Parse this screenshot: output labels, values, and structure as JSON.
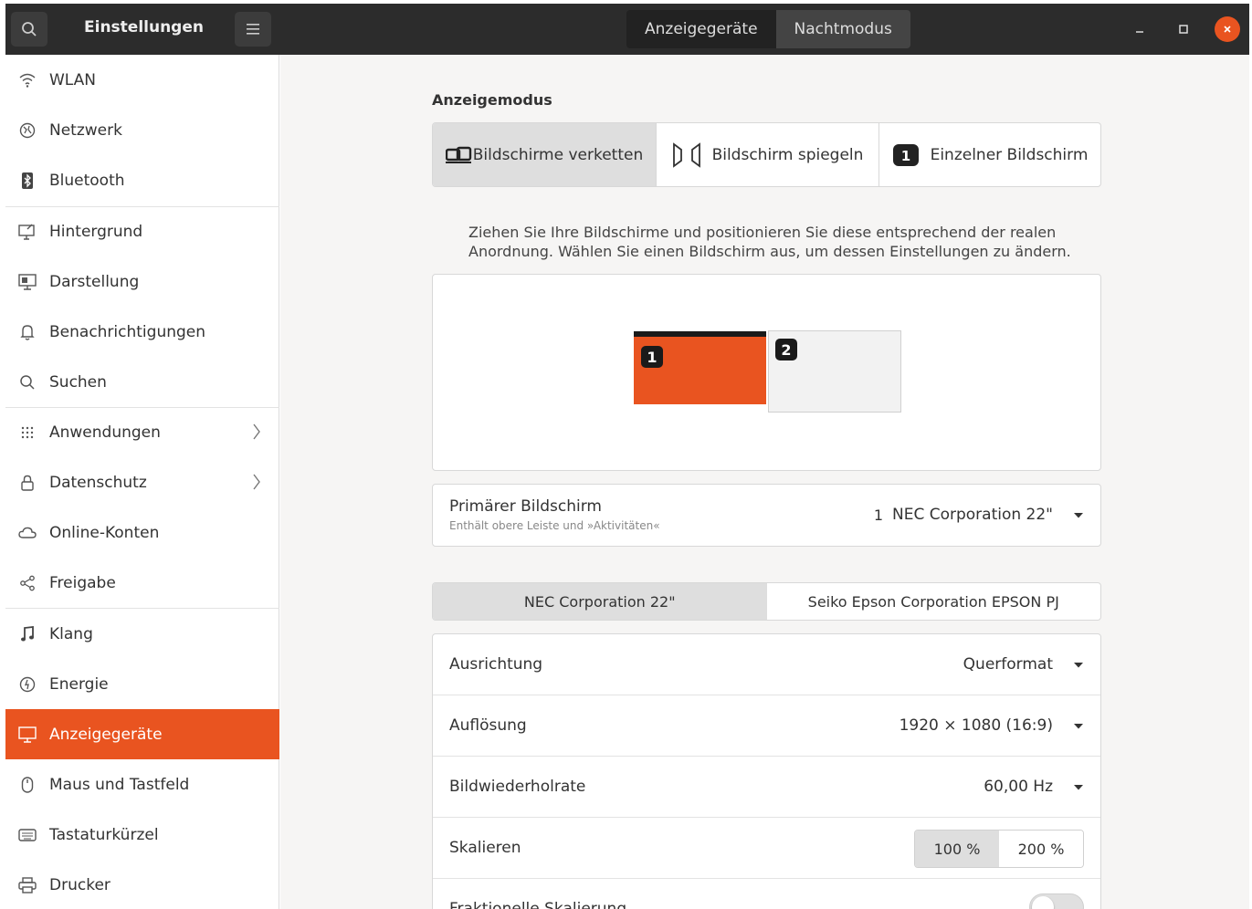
{
  "header": {
    "title": "Einstellungen",
    "tabs": [
      {
        "label": "Anzeigegeräte",
        "active": true
      },
      {
        "label": "Nachtmodus",
        "active": false
      }
    ]
  },
  "sidebar": {
    "items": [
      {
        "label": "WLAN",
        "icon": "wifi-icon"
      },
      {
        "label": "Netzwerk",
        "icon": "network-icon"
      },
      {
        "label": "Bluetooth",
        "icon": "bluetooth-icon"
      },
      {
        "label": "Hintergrund",
        "icon": "background-icon"
      },
      {
        "label": "Darstellung",
        "icon": "appearance-icon"
      },
      {
        "label": "Benachrichtigungen",
        "icon": "bell-icon"
      },
      {
        "label": "Suchen",
        "icon": "search-icon"
      },
      {
        "label": "Anwendungen",
        "icon": "apps-grid-icon"
      },
      {
        "label": "Datenschutz",
        "icon": "lock-icon"
      },
      {
        "label": "Online-Konten",
        "icon": "cloud-icon"
      },
      {
        "label": "Freigabe",
        "icon": "share-icon"
      },
      {
        "label": "Klang",
        "icon": "music-note-icon"
      },
      {
        "label": "Energie",
        "icon": "power-icon"
      },
      {
        "label": "Anzeigegeräte",
        "icon": "display-icon",
        "active": true
      },
      {
        "label": "Maus und Tastfeld",
        "icon": "mouse-icon"
      },
      {
        "label": "Tastaturkürzel",
        "icon": "keyboard-icon"
      },
      {
        "label": "Drucker",
        "icon": "printer-icon"
      }
    ]
  },
  "main": {
    "section_title": "Anzeigemodus",
    "modes": [
      {
        "label": "Bildschirme verketten",
        "icon": "join-displays-icon",
        "selected": true
      },
      {
        "label": "Bildschirm spiegeln",
        "icon": "mirror-icon",
        "selected": false
      },
      {
        "label": "Einzelner Bildschirm",
        "icon": "single-display-icon",
        "selected": false
      }
    ],
    "hint": "Ziehen Sie Ihre Bildschirme und positionieren Sie diese entsprechend der realen Anordnung. Wählen Sie einen Bildschirm aus, um dessen Einstellungen zu ändern.",
    "arrangement": {
      "monitor1_label": "1",
      "monitor2_label": "2"
    },
    "primary": {
      "label": "Primärer Bildschirm",
      "sublabel": "Enthält obere Leiste und »Aktivitäten«",
      "number": "1",
      "value": "NEC Corporation 22\""
    },
    "monitor_tabs": [
      {
        "label": "NEC Corporation 22\"",
        "selected": true
      },
      {
        "label": "Seiko Epson Corporation EPSON PJ",
        "selected": false
      }
    ],
    "settings": {
      "orientation": {
        "label": "Ausrichtung",
        "value": "Querformat"
      },
      "resolution": {
        "label": "Auflösung",
        "value": "1920 × 1080 (16:9)"
      },
      "refresh": {
        "label": "Bildwiederholrate",
        "value": "60,00 Hz"
      },
      "scale": {
        "label": "Skalieren",
        "options": [
          "100 %",
          "200 %"
        ],
        "selected": "100 %"
      },
      "fractional": {
        "label": "Fraktionelle Skalierung",
        "enabled": false
      }
    }
  },
  "colors": {
    "accent": "#e95420",
    "headerbar": "#2c2c2c",
    "background": "#f6f5f4"
  }
}
